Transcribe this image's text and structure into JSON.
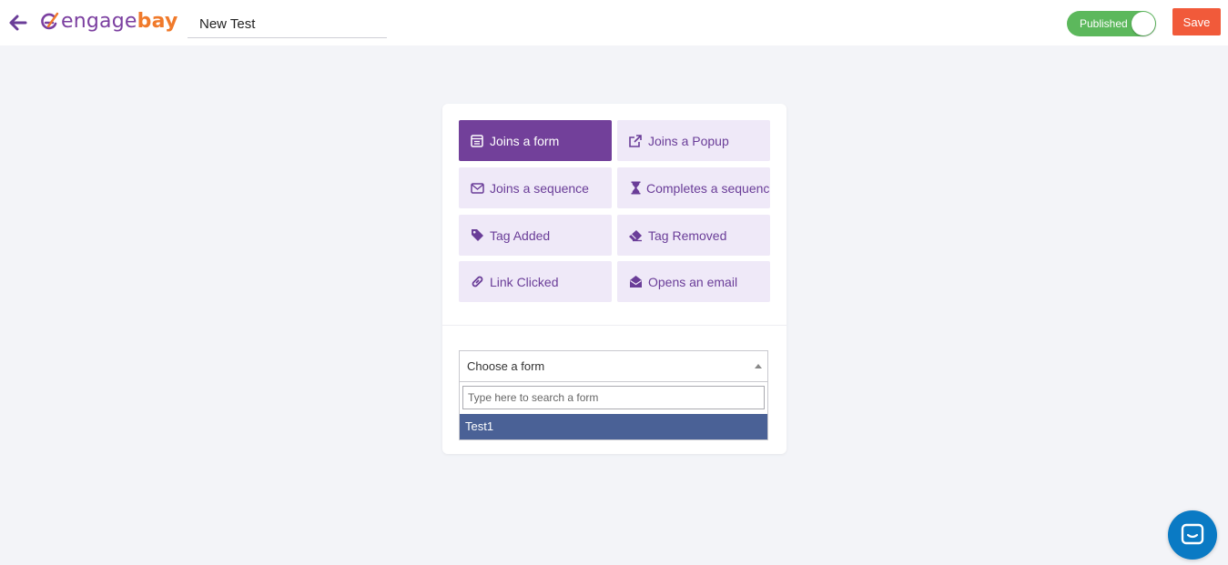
{
  "header": {
    "back_icon": "arrow-left-icon",
    "logo": {
      "part1": "engage",
      "part2": "bay"
    },
    "title_value": "New Test",
    "published_label": "Published",
    "published": true,
    "save_label": "Save"
  },
  "colors": {
    "brand_purple": "#72409a",
    "brand_orange": "#f07a2b",
    "trigger_bg": "#efe9f8",
    "save_red": "#f15a3a",
    "toggle_green": "#5cb85c",
    "option_highlight": "#4a6196",
    "chat_blue": "#0a7ac4"
  },
  "triggers": [
    {
      "label": "Joins a form",
      "icon": "form-icon",
      "active": true
    },
    {
      "label": "Joins a Popup",
      "icon": "external-link-icon",
      "active": false
    },
    {
      "label": "Joins a sequence",
      "icon": "envelope-icon",
      "active": false
    },
    {
      "label": "Completes a sequence",
      "icon": "hourglass-icon",
      "active": false
    },
    {
      "label": "Tag Added",
      "icon": "tag-icon",
      "active": false
    },
    {
      "label": "Tag Removed",
      "icon": "eraser-icon",
      "active": false
    },
    {
      "label": "Link Clicked",
      "icon": "link-icon",
      "active": false
    },
    {
      "label": "Opens an email",
      "icon": "envelope-open-icon",
      "active": false
    }
  ],
  "form_select": {
    "selected_text": "Choose a form",
    "search_placeholder": "Type here to search a form",
    "options": [
      "Test1"
    ]
  },
  "chat": {
    "icon": "chat-bubble-icon"
  }
}
